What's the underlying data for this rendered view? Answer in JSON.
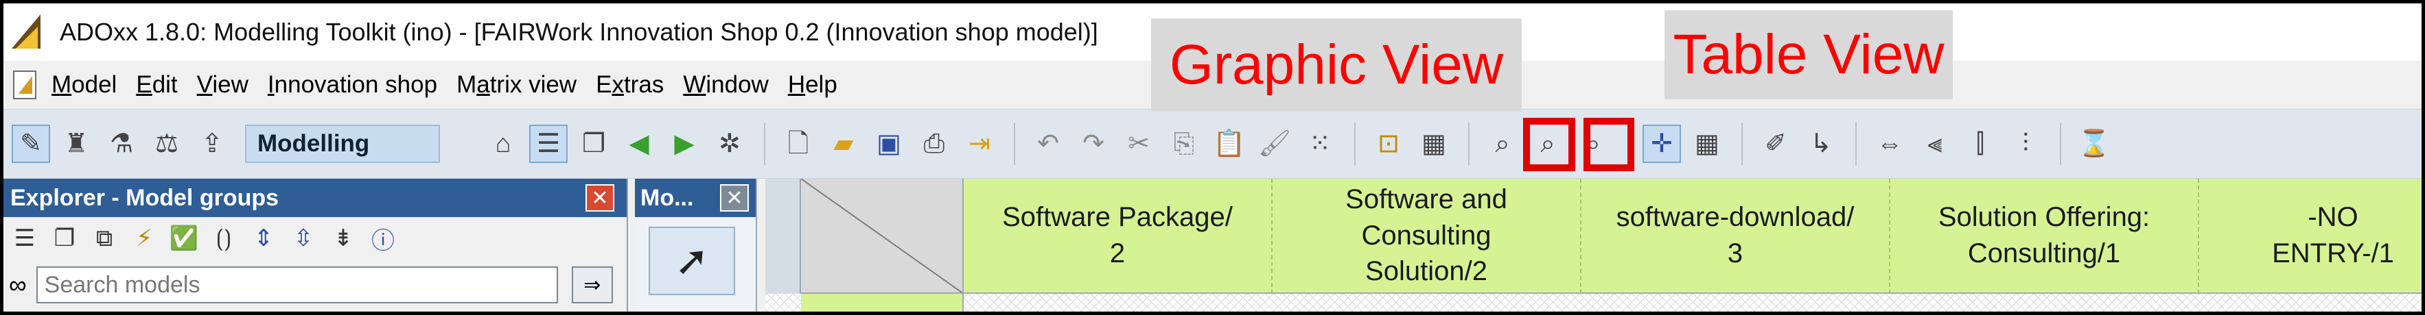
{
  "window": {
    "title": "ADOxx 1.8.0: Modelling Toolkit (ino) - [FAIRWork Innovation Shop 0.2 (Innovation shop model)]"
  },
  "menu": {
    "items": [
      {
        "label": "Model",
        "mnemonic": "M",
        "rest": "odel"
      },
      {
        "label": "Edit",
        "mnemonic": "E",
        "rest": "dit"
      },
      {
        "label": "View",
        "mnemonic": "V",
        "rest": "iew"
      },
      {
        "label": "Innovation shop",
        "mnemonic": "I",
        "rest": "nnovation shop"
      },
      {
        "label": "Matrix view",
        "pre": "M",
        "mnemonic": "a",
        "rest": "trix view"
      },
      {
        "label": "Extras",
        "pre": "E",
        "mnemonic": "x",
        "rest": "tras"
      },
      {
        "label": "Window",
        "mnemonic": "W",
        "rest": "indow"
      },
      {
        "label": "Help",
        "mnemonic": "H",
        "rest": "elp"
      }
    ]
  },
  "toolbar": {
    "mode_label": "Modelling"
  },
  "callouts": {
    "graphic_view": "Graphic View",
    "table_view": "Table View"
  },
  "explorer": {
    "title": "Explorer - Model groups",
    "search_placeholder": "Search models"
  },
  "modelling_bar": {
    "title": "Mo..."
  },
  "matrix": {
    "columns": [
      "Software Package/\n2",
      "Software and\nConsulting\nSolution/2",
      "software-download/\n3",
      "Solution Offering:\nConsulting/1",
      "-NO ENTRY-/1"
    ]
  },
  "colors": {
    "header_accent": "#2f5d96",
    "highlight_red": "#e00000",
    "callout_text": "#ff0000",
    "column_header_bg": "#d6f394"
  }
}
